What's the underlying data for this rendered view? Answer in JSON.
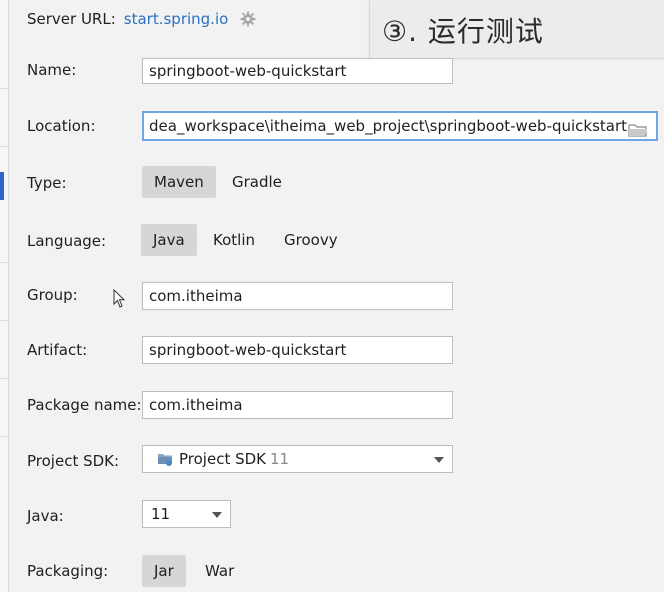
{
  "server": {
    "label": "Server URL:",
    "url": "start.spring.io"
  },
  "overlay": {
    "text": "③. 运行测试"
  },
  "fields": {
    "name": {
      "label": "Name:",
      "value": "springboot-web-quickstart"
    },
    "location": {
      "label": "Location:",
      "value": "dea_workspace\\itheima_web_project\\springboot-web-quickstart"
    },
    "group": {
      "label": "Group:",
      "value": "com.itheima"
    },
    "artifact": {
      "label": "Artifact:",
      "value": "springboot-web-quickstart"
    },
    "package_name": {
      "label": "Package name:",
      "value": "com.itheima"
    }
  },
  "type": {
    "label": "Type:",
    "options": [
      "Maven",
      "Gradle"
    ],
    "selected": "Maven"
  },
  "language": {
    "label": "Language:",
    "options": [
      "Java",
      "Kotlin",
      "Groovy"
    ],
    "selected": "Java"
  },
  "project_sdk": {
    "label": "Project SDK:",
    "value": "Project SDK",
    "version": "11"
  },
  "java": {
    "label": "Java:",
    "value": "11"
  },
  "packaging": {
    "label": "Packaging:",
    "options": [
      "Jar",
      "War"
    ],
    "selected": "Jar"
  },
  "colors": {
    "accent": "#2d6fc2",
    "focus_border": "#6fa3ea",
    "selected_segment": "#d6d6d6"
  },
  "icons": {
    "settings": "gear-icon",
    "browse": "folder-icon",
    "sdk": "sdk-folder-icon",
    "dropdown": "chevron-down-icon",
    "pointer": "mouse-cursor-icon"
  }
}
